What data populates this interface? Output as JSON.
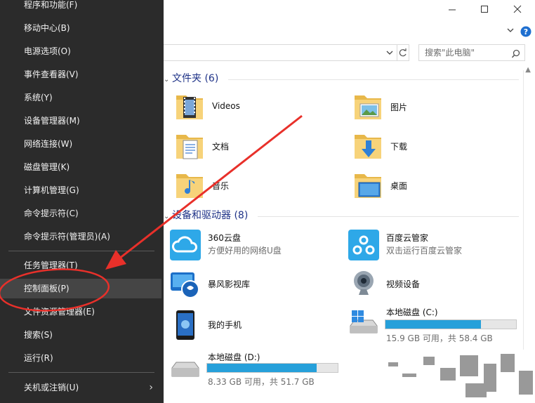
{
  "winx_menu": {
    "items": [
      {
        "label": "程序和功能(F)"
      },
      {
        "label": "移动中心(B)"
      },
      {
        "label": "电源选项(O)"
      },
      {
        "label": "事件查看器(V)"
      },
      {
        "label": "系统(Y)"
      },
      {
        "label": "设备管理器(M)"
      },
      {
        "label": "网络连接(W)"
      },
      {
        "label": "磁盘管理(K)"
      },
      {
        "label": "计算机管理(G)"
      },
      {
        "label": "命令提示符(C)"
      },
      {
        "label": "命令提示符(管理员)(A)"
      },
      {
        "label": "任务管理器(T)"
      },
      {
        "label": "控制面板(P)"
      },
      {
        "label": "文件资源管理器(E)"
      },
      {
        "label": "搜索(S)"
      },
      {
        "label": "运行(R)"
      },
      {
        "label": "关机或注销(U)"
      }
    ],
    "highlighted": "控制面板(P)"
  },
  "explorer": {
    "search_placeholder": "搜索\"此电脑\"",
    "folders_header": "文件夹 (6)",
    "folders": [
      {
        "label": "Videos",
        "icon": "videos-folder-icon"
      },
      {
        "label": "图片",
        "icon": "pictures-folder-icon"
      },
      {
        "label": "文档",
        "icon": "documents-folder-icon"
      },
      {
        "label": "下载",
        "icon": "downloads-folder-icon"
      },
      {
        "label": "音乐",
        "icon": "music-folder-icon"
      },
      {
        "label": "桌面",
        "icon": "desktop-folder-icon"
      }
    ],
    "devices_header": "设备和驱动器 (8)",
    "devices": [
      {
        "label": "360云盘",
        "sub": "方便好用的网络U盘",
        "icon": "cloud-360-icon"
      },
      {
        "label": "百度云管家",
        "sub": "双击运行百度云管家",
        "icon": "baidu-cloud-icon"
      },
      {
        "label": "暴风影视库",
        "icon": "storm-video-icon"
      },
      {
        "label": "视频设备",
        "icon": "webcam-icon"
      },
      {
        "label": "我的手机",
        "icon": "phone-icon"
      },
      {
        "label": "本地磁盘 (C:)",
        "sub": "15.9 GB 可用，共 58.4 GB",
        "used_fraction": 0.73,
        "icon": "drive-c-icon"
      },
      {
        "label": "本地磁盘 (D:)",
        "sub": "8.33 GB 可用，共 51.7 GB",
        "used_fraction": 0.84,
        "icon": "drive-d-icon"
      }
    ]
  },
  "colors": {
    "menu_bg": "#2b2b2b",
    "menu_highlight": "#454545",
    "annotation_red": "#e8302a",
    "group_header": "#1e3287",
    "drive_bar_fill": "#26a0da"
  }
}
